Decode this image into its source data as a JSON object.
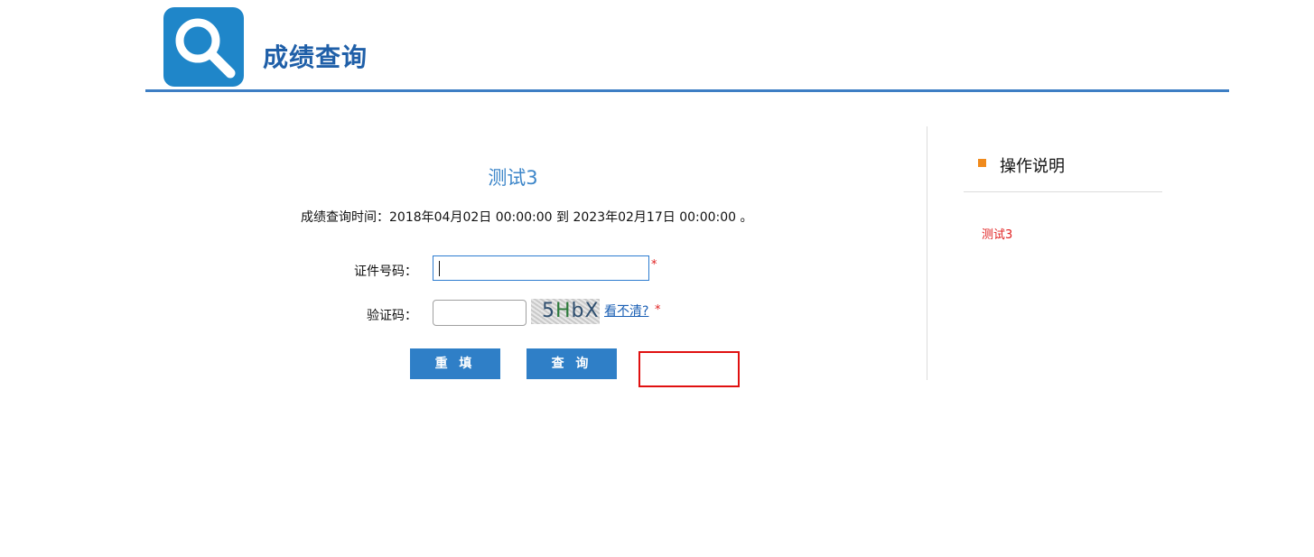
{
  "header": {
    "logo_icon": "magnifier-icon",
    "title": "成绩查询"
  },
  "main": {
    "exam_title": "测试3",
    "time_text": "成绩查询时间：2018年04月02日 00:00:00 到 2023年02月17日 00:00:00 。",
    "id_label": "证件号码：",
    "id_value": "",
    "captcha_label": "验证码：",
    "captcha_value": "",
    "captcha_code_1": "5",
    "captcha_code_2": "H",
    "captcha_code_3": "bX",
    "refresh_link": "看不清?",
    "required_mark": "*",
    "reset_button": "重 填",
    "query_button": "查 询"
  },
  "sidebar": {
    "title": "操作说明",
    "item": "测试3"
  },
  "colors": {
    "brand_blue": "#1f86c9",
    "button_blue": "#2f7fc7",
    "accent_orange": "#f08a1c",
    "required_red": "#e02020"
  }
}
